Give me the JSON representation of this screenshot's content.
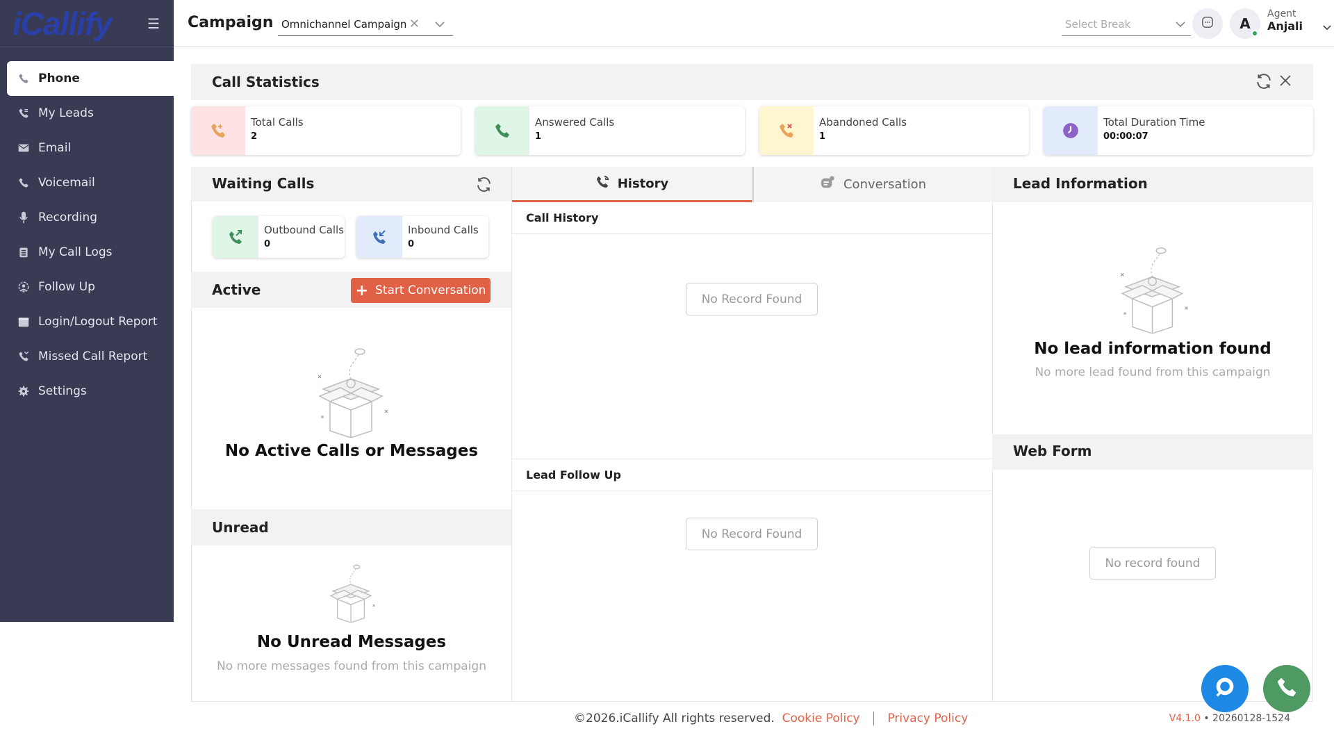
{
  "brand": {
    "logo": "iCallify"
  },
  "sidebar": {
    "items": [
      {
        "label": "Phone",
        "icon": "phone-icon"
      },
      {
        "label": "My Leads",
        "icon": "leads-icon"
      },
      {
        "label": "Email",
        "icon": "email-icon"
      },
      {
        "label": "Voicemail",
        "icon": "voicemail-icon"
      },
      {
        "label": "Recording",
        "icon": "microphone-icon"
      },
      {
        "label": "My Call Logs",
        "icon": "call-logs-icon"
      },
      {
        "label": "Follow Up",
        "icon": "follow-up-icon"
      },
      {
        "label": "Login/Logout Report",
        "icon": "calendar-icon"
      },
      {
        "label": "Missed Call Report",
        "icon": "missed-call-icon"
      },
      {
        "label": "Settings",
        "icon": "gear-icon"
      }
    ]
  },
  "header": {
    "title": "Campaign",
    "campaign_value": "Omnichannel Campaign",
    "break_placeholder": "Select Break",
    "avatar_letter": "A",
    "agent_role": "Agent",
    "agent_name": "Anjali"
  },
  "stats": {
    "title": "Call Statistics",
    "cards": [
      {
        "label": "Total Calls",
        "value": "2",
        "color": "#fde3e3"
      },
      {
        "label": "Answered Calls",
        "value": "1",
        "color": "#dff5e6"
      },
      {
        "label": "Abandoned Calls",
        "value": "1",
        "color": "#fdf6cf"
      },
      {
        "label": "Total Duration Time",
        "value": "00:00:07",
        "color": "#e2ebfb"
      }
    ]
  },
  "waiting": {
    "title": "Waiting Calls",
    "outbound_label": "Outbound Calls",
    "outbound_value": "0",
    "inbound_label": "Inbound Calls",
    "inbound_value": "0"
  },
  "active": {
    "title": "Active",
    "start_button": "Start Conversation",
    "empty_title": "No Active Calls or Messages"
  },
  "unread": {
    "title": "Unread",
    "empty_title": "No Unread Messages",
    "empty_sub": "No more messages found from this campaign"
  },
  "tabs": {
    "history": "History",
    "conversation": "Conversation"
  },
  "history": {
    "call_history_title": "Call History",
    "call_history_empty": "No Record Found",
    "lead_follow_title": "Lead Follow Up",
    "lead_follow_empty": "No Record Found"
  },
  "lead": {
    "title": "Lead Information",
    "empty_title": "No lead information found",
    "empty_sub": "No more lead found from this campaign"
  },
  "webform": {
    "title": "Web Form",
    "empty": "No record found"
  },
  "footer": {
    "copyright": "©2026.iCallify All rights reserved.",
    "cookie": "Cookie Policy",
    "privacy": "Privacy Policy",
    "version": "V4.1.0",
    "build": "• 20260128-1524"
  },
  "colors": {
    "accent": "#e06146",
    "sidebar": "#383b53",
    "fab_chat": "#1e88e5",
    "fab_call": "#4e9a62"
  }
}
